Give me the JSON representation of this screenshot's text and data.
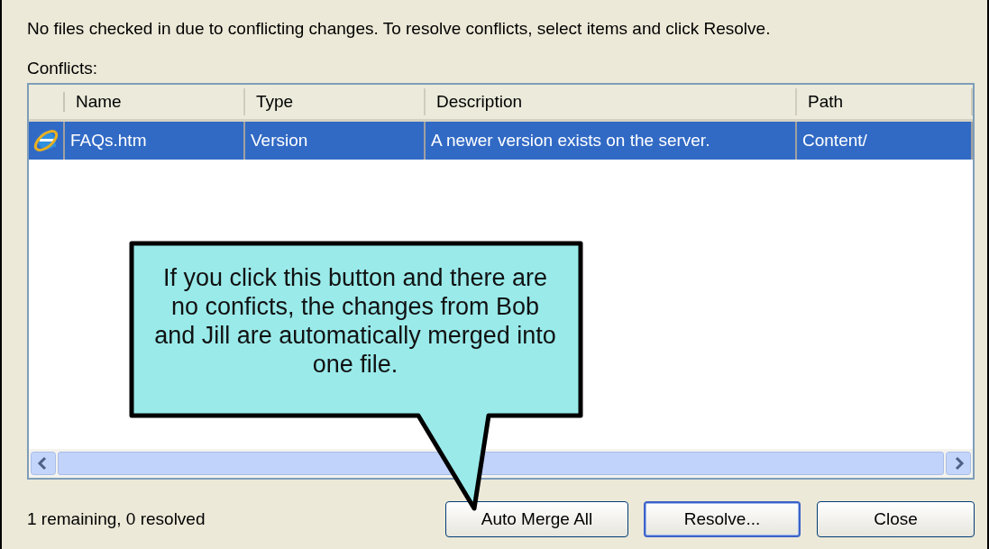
{
  "message": "No files checked in due to conflicting changes.  To resolve conflicts, select items and click Resolve.",
  "conflicts_label": "Conflicts:",
  "table": {
    "columns": [
      "Name",
      "Type",
      "Description",
      "Path"
    ],
    "rows": [
      {
        "name": "FAQs.htm",
        "type": "Version",
        "description": "A newer version exists on the server.",
        "path": "Content/",
        "selected": true
      }
    ]
  },
  "status": "1 remaining, 0 resolved",
  "buttons": [
    {
      "label": "Auto Merge All",
      "default": false
    },
    {
      "label": "Resolve...",
      "default": true
    },
    {
      "label": "Close",
      "default": false
    }
  ],
  "callout": {
    "text": "If you click this button and there are no conficts, the changes from Bob and Jill are automatically merged into one file."
  }
}
